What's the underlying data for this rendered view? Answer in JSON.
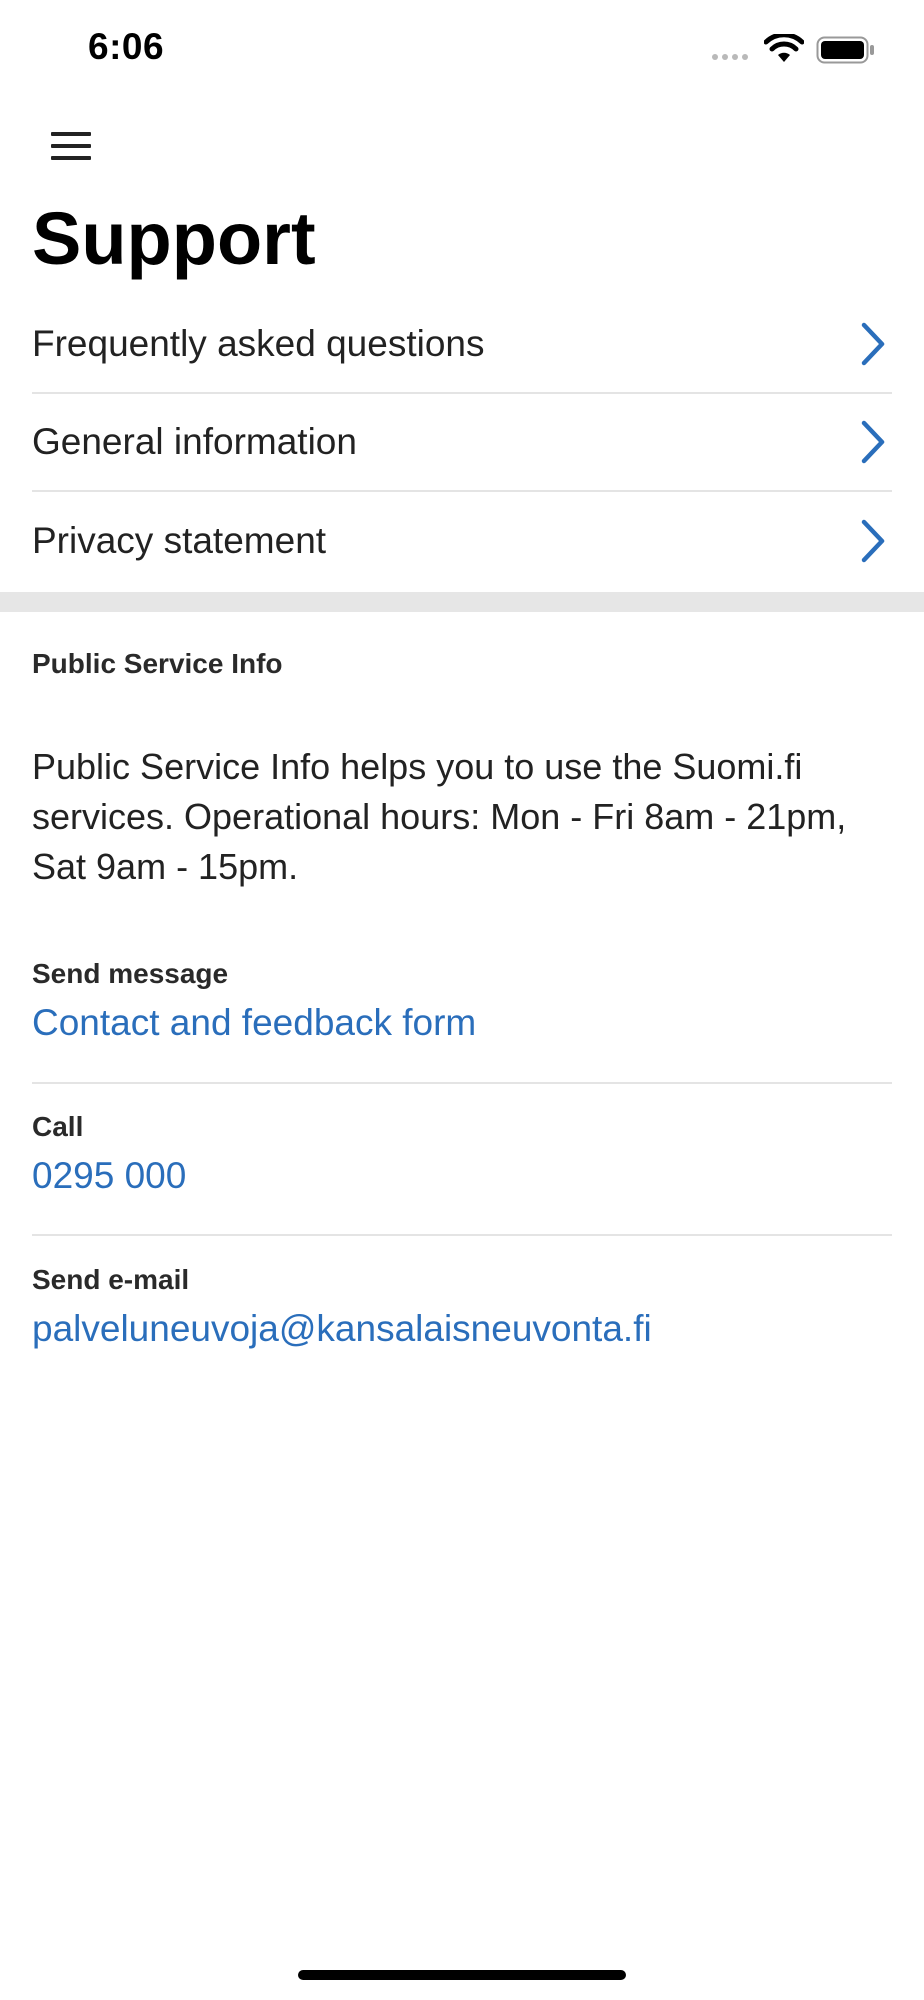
{
  "status_bar": {
    "time": "6:06"
  },
  "header": {
    "menu_icon": "hamburger-menu-icon",
    "title": "Support"
  },
  "nav": {
    "items": [
      {
        "label": "Frequently asked questions",
        "icon": "chevron-right-icon"
      },
      {
        "label": "General information",
        "icon": "chevron-right-icon"
      },
      {
        "label": "Privacy statement",
        "icon": "chevron-right-icon"
      }
    ]
  },
  "info": {
    "heading": "Public Service Info",
    "text": "Public Service Info helps you to use the Suomi.fi services. Operational hours: Mon - Fri 8am - 21pm, Sat 9am - 15pm."
  },
  "contacts": {
    "message": {
      "label": "Send message",
      "link": "Contact and feedback form"
    },
    "call": {
      "label": "Call",
      "link": "0295 000"
    },
    "email": {
      "label": "Send e-mail",
      "link": "palveluneuvoja@kansalaisneuvonta.fi"
    }
  },
  "colors": {
    "accent": "#2a6ebb",
    "divider": "#e4e4e4",
    "section_divider": "#e6e6e6",
    "text": "#222222"
  }
}
